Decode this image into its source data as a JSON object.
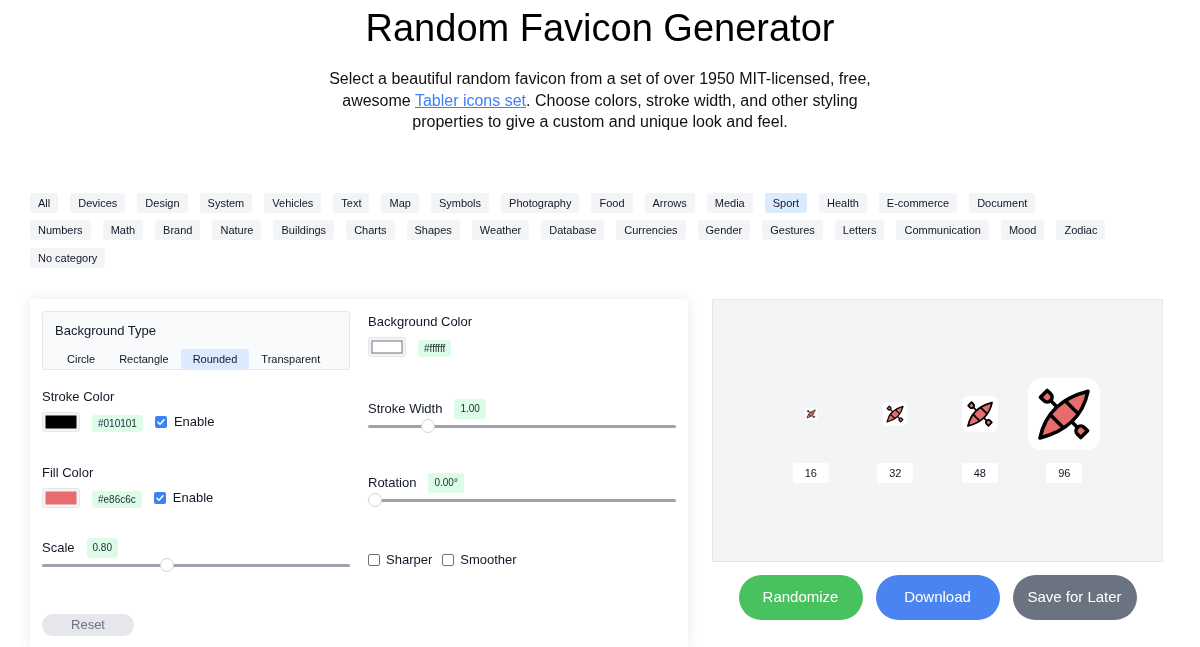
{
  "title": "Random Favicon Generator",
  "description": {
    "text_before": "Select a beautiful random favicon from a set of over 1950 MIT-licensed, free, awesome",
    "link": "Tabler icons set",
    "text_after": ". Choose colors, stroke width, and other styling properties to give a custom and unique look and feel."
  },
  "category_rows": [
    [
      {
        "label": "All",
        "selected": false
      },
      {
        "label": "Devices",
        "selected": false
      },
      {
        "label": "Design",
        "selected": false
      },
      {
        "label": "System",
        "selected": false
      },
      {
        "label": "Vehicles",
        "selected": false
      },
      {
        "label": "Text",
        "selected": false
      },
      {
        "label": "Map",
        "selected": false
      },
      {
        "label": "Symbols",
        "selected": false
      },
      {
        "label": "Photography",
        "selected": false
      },
      {
        "label": "Food",
        "selected": false
      },
      {
        "label": "Arrows",
        "selected": false
      },
      {
        "label": "Media",
        "selected": false
      },
      {
        "label": "Sport",
        "selected": true
      },
      {
        "label": "Health",
        "selected": false
      },
      {
        "label": "E-commerce",
        "selected": false
      },
      {
        "label": "Document",
        "selected": false
      }
    ],
    [
      {
        "label": "Numbers",
        "selected": false
      },
      {
        "label": "Math",
        "selected": false
      },
      {
        "label": "Brand",
        "selected": false
      },
      {
        "label": "Nature",
        "selected": false
      },
      {
        "label": "Buildings",
        "selected": false
      },
      {
        "label": "Charts",
        "selected": false
      },
      {
        "label": "Shapes",
        "selected": false
      },
      {
        "label": "Weather",
        "selected": false
      },
      {
        "label": "Database",
        "selected": false
      },
      {
        "label": "Currencies",
        "selected": false
      },
      {
        "label": "Gender",
        "selected": false
      },
      {
        "label": "Gestures",
        "selected": false
      },
      {
        "label": "Letters",
        "selected": false
      },
      {
        "label": "Communication",
        "selected": false
      },
      {
        "label": "Mood",
        "selected": false
      },
      {
        "label": "Zodiac",
        "selected": false
      }
    ],
    [
      {
        "label": "No category",
        "selected": false
      }
    ]
  ],
  "controls": {
    "background_type": {
      "label": "Background Type",
      "options": [
        {
          "label": "Circle",
          "selected": false
        },
        {
          "label": "Rectangle",
          "selected": false
        },
        {
          "label": "Rounded",
          "selected": true
        },
        {
          "label": "Transparent",
          "selected": false
        }
      ]
    },
    "background_color": {
      "label": "Background Color",
      "color": "#ffffff",
      "value": "#ffffff"
    },
    "stroke_color": {
      "label": "Stroke Color",
      "color": "#010101",
      "value": "#010101",
      "enable": {
        "label": "Enable",
        "checked": true
      }
    },
    "fill_color": {
      "label": "Fill Color",
      "color": "#e86c6c",
      "value": "#e86c6c",
      "enable": {
        "label": "Enable",
        "checked": true
      }
    },
    "scale": {
      "label": "Scale",
      "value": "0.80",
      "level": 0.4
    },
    "stroke_width": {
      "label": "Stroke Width",
      "value": "1.00",
      "level": 0.18
    },
    "rotation": {
      "label": "Rotation",
      "value": "0.00°",
      "level": 0
    },
    "options": [
      {
        "label": "Sharper",
        "checked": false
      },
      {
        "label": "Smoother",
        "checked": false
      }
    ],
    "reset_button": "Reset"
  },
  "preview": {
    "sizes": [
      "16",
      "32",
      "48",
      "96"
    ]
  },
  "actions": [
    {
      "label": "Randomize",
      "color": "#48c15f"
    },
    {
      "label": "Download",
      "color": "#4a84f0"
    },
    {
      "label": "Save for Later",
      "color": "#6b7280"
    }
  ]
}
